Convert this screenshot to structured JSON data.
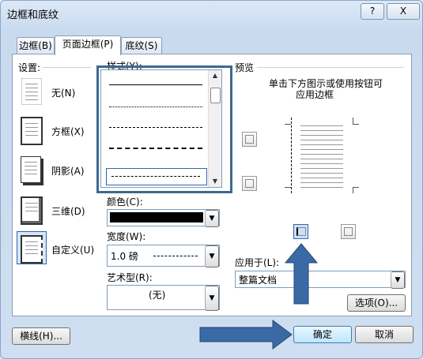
{
  "window": {
    "title": "边框和底纹",
    "help_label": "?",
    "close_label": "X"
  },
  "tabs": [
    {
      "label": "边框(B)"
    },
    {
      "label": "页面边框(P)"
    },
    {
      "label": "底纹(S)"
    }
  ],
  "setting": {
    "heading": "设置:",
    "options": [
      {
        "label": "无(N)"
      },
      {
        "label": "方框(X)"
      },
      {
        "label": "阴影(A)"
      },
      {
        "label": "三维(D)"
      },
      {
        "label": "自定义(U)"
      }
    ]
  },
  "style": {
    "heading": "样式(Y):"
  },
  "color": {
    "label": "颜色(C):",
    "value_color": "#000000"
  },
  "width": {
    "label": "宽度(W):",
    "value": "1.0 磅"
  },
  "art": {
    "label": "艺术型(R):",
    "value": "(无)"
  },
  "preview": {
    "heading": "预览",
    "instruction_line1": "单击下方图示或使用按钮可",
    "instruction_line2": "应用边框"
  },
  "apply_to": {
    "label": "应用于(L):",
    "value": "整篇文档"
  },
  "buttons": {
    "options": "选项(O)...",
    "horizontal_line": "横线(H)...",
    "ok": "确定",
    "cancel": "取消"
  },
  "colors": {
    "accent": "#3f6892",
    "arrow_fill": "#3a6aa6"
  }
}
